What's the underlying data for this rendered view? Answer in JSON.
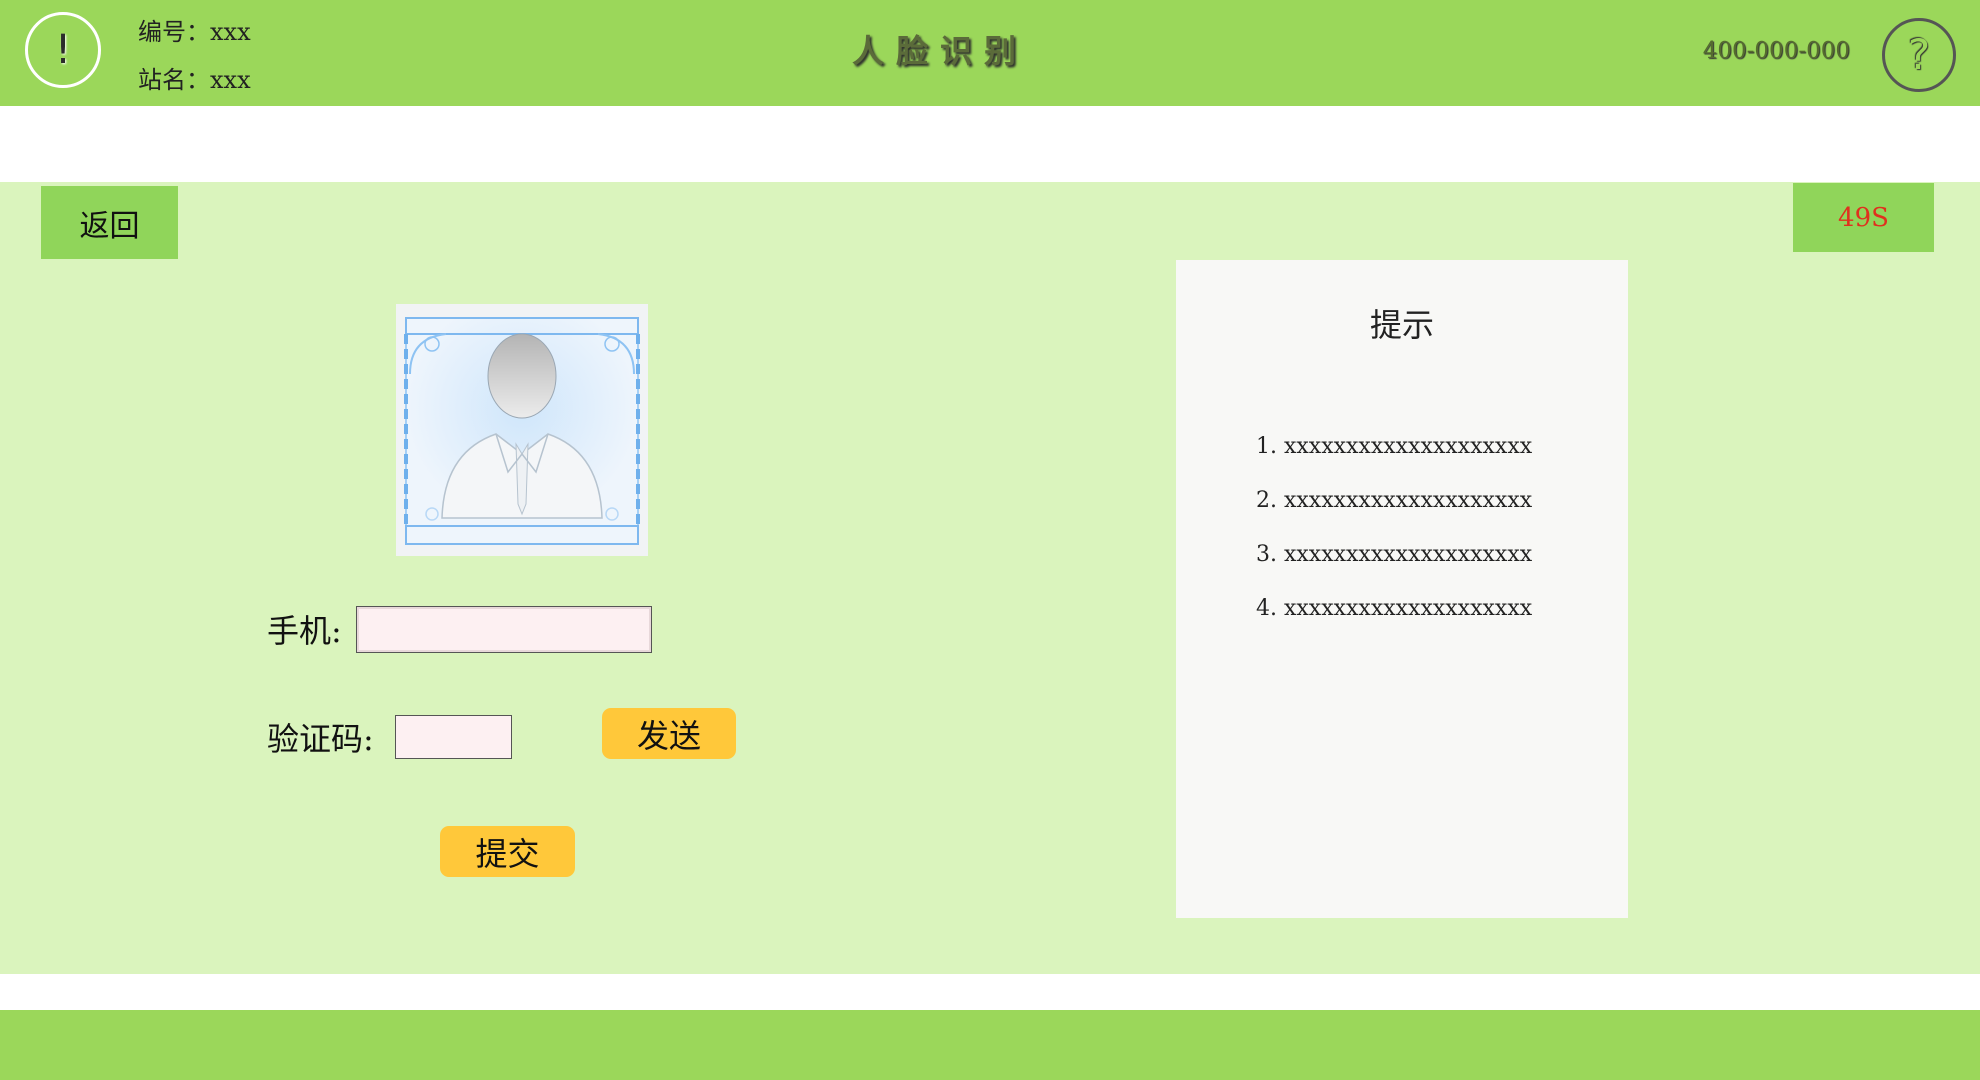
{
  "header": {
    "alert_icon": "exclamation-icon",
    "alert_glyph": "!",
    "station_id_label": "编号：",
    "station_id_value": "xxx",
    "station_name_label": "站名：",
    "station_name_value": "xxx",
    "title": "人脸识别",
    "hotline": "400-000-000",
    "help_icon": "question-mark-icon",
    "help_glyph": "?"
  },
  "nav": {
    "back_label": "返回",
    "countdown": "49S"
  },
  "face_capture": {
    "icon": "face-silhouette-icon"
  },
  "form": {
    "phone_label": "手机:",
    "phone_value": "",
    "phone_placeholder": "",
    "code_label": "验证码:",
    "code_value": "",
    "code_placeholder": "",
    "send_label": "发送",
    "submit_label": "提交"
  },
  "tips": {
    "title": "提示",
    "items": [
      "1. xxxxxxxxxxxxxxxxxxxx",
      "2. xxxxxxxxxxxxxxxxxxxx",
      "3. xxxxxxxxxxxxxxxxxxxx",
      "4. xxxxxxxxxxxxxxxxxxxx"
    ]
  },
  "colors": {
    "header_green": "#9bd75a",
    "panel_green": "#daf4bd",
    "button_green": "#90d55a",
    "action_yellow": "#ffc83a",
    "countdown_red": "#e0301e",
    "tips_bg": "#f8f8f6"
  }
}
